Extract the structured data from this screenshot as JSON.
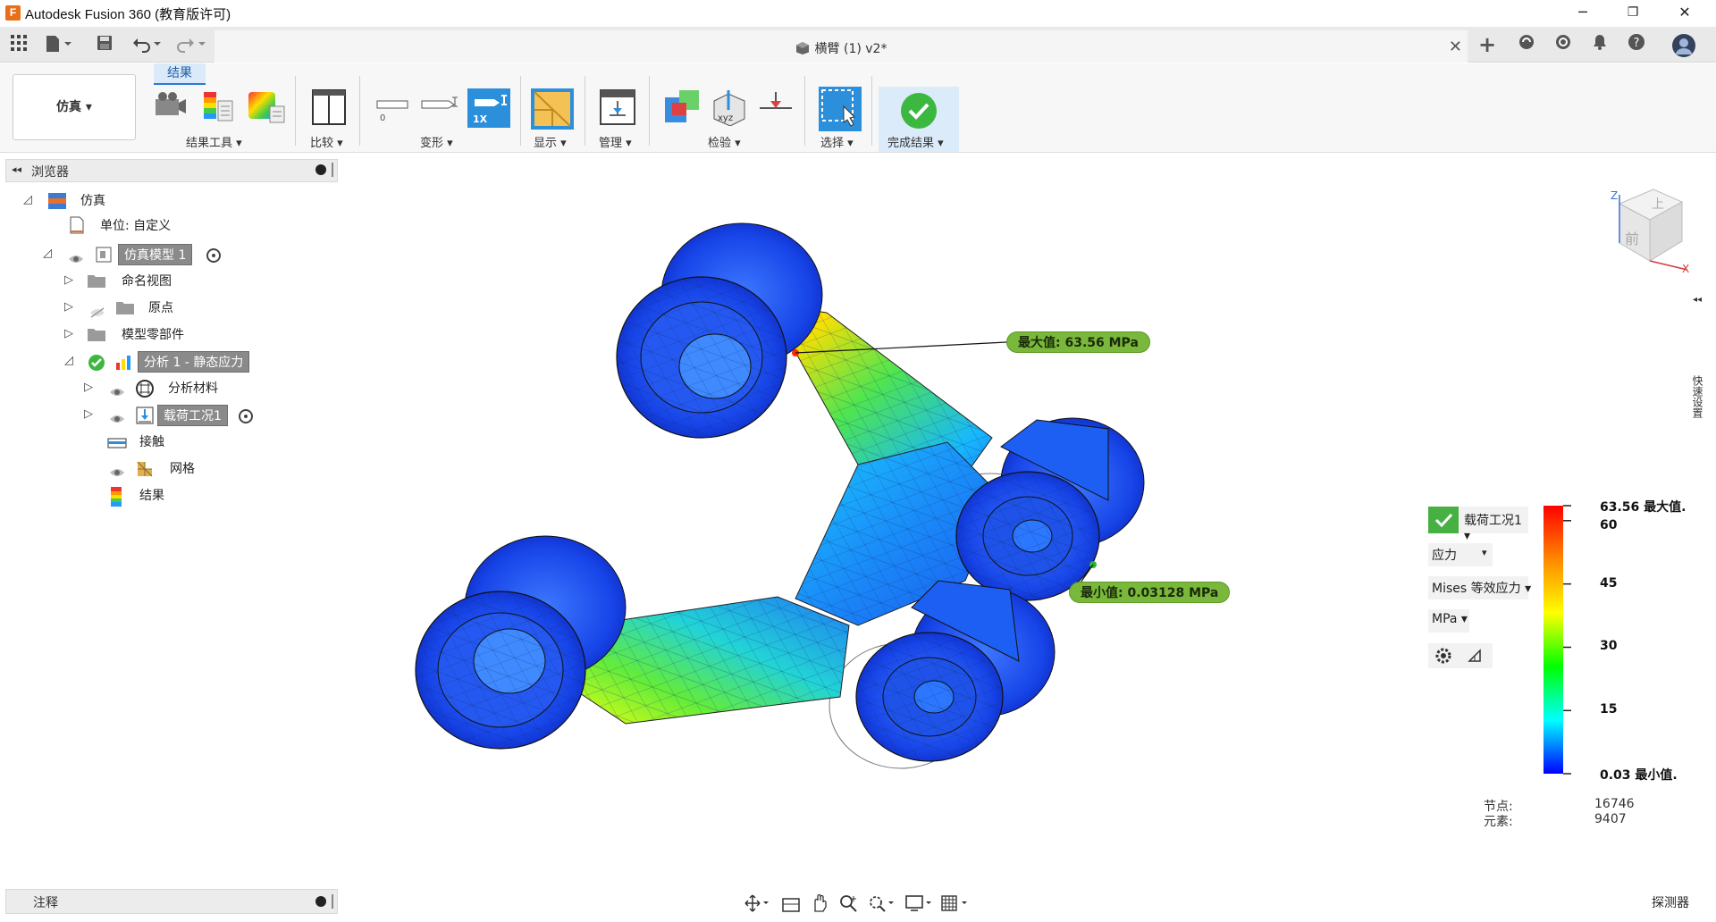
{
  "window": {
    "title": "Autodesk Fusion 360 (教育版许可)",
    "logo_letter": "F",
    "minimize": "─",
    "restore": "❐",
    "close": "✕"
  },
  "tabbar": {
    "doc_title": "横臂 (1) v2*",
    "doc_close": "✕",
    "new_tab": "+"
  },
  "toolbar": {
    "workspace": "仿真 ▾",
    "active_tab": "结果",
    "groups": {
      "result_tools": "结果工具 ▾",
      "compare": "比较 ▾",
      "deform": "变形 ▾",
      "display": "显示 ▾",
      "manage": "管理 ▾",
      "inspect": "检验 ▾",
      "select": "选择 ▾",
      "finish": "完成结果 ▾"
    },
    "deform_scale_label": "1X",
    "inspect_xyz": "xyz"
  },
  "browser": {
    "header": "浏览器",
    "items": [
      {
        "label": "仿真"
      },
      {
        "label": "单位: 自定义"
      },
      {
        "label": "仿真模型 1"
      },
      {
        "label": "命名视图"
      },
      {
        "label": "原点"
      },
      {
        "label": "模型零部件"
      },
      {
        "label": "分析 1 - 静态应力"
      },
      {
        "label": "分析材料"
      },
      {
        "label": "载荷工况1"
      },
      {
        "label": "接触"
      },
      {
        "label": "网格"
      },
      {
        "label": "结果"
      }
    ]
  },
  "comments": {
    "header": "注释"
  },
  "viewport": {
    "max_callout": "最大值: 63.56 MPa",
    "min_callout": "最小值: 0.03128 MPa",
    "viewcube_front": "前",
    "viewcube_top": "上",
    "axis_z": "Z",
    "axis_x": "X"
  },
  "legend": {
    "load_case": "载荷工况1 ▾",
    "result_type": "应力",
    "result_type_arrow": "▾",
    "component": "Mises 等效应力 ▾",
    "units": "MPa ▾",
    "ticks": [
      {
        "label": "63.56 最大值.",
        "value": 63.56
      },
      {
        "label": "60",
        "value": 60
      },
      {
        "label": "45",
        "value": 45
      },
      {
        "label": "30",
        "value": 30
      },
      {
        "label": "15",
        "value": 15
      },
      {
        "label": "0.03 最小值.",
        "value": 0.03
      }
    ],
    "colors": [
      "#ff0000",
      "#ff8800",
      "#ffff00",
      "#00ff00",
      "#00ffff",
      "#0000ff"
    ],
    "nodes_label": "节点:",
    "nodes_value": "16746",
    "elements_label": "元素:",
    "elements_value": "9407"
  },
  "side_panel": {
    "label": "快速设置"
  },
  "inspector": {
    "label": "探测器"
  }
}
